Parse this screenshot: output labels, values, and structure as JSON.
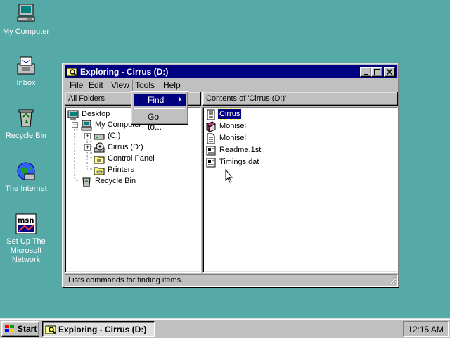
{
  "desktop": {
    "icons": [
      {
        "label": "My Computer",
        "icon": "computer-icon"
      },
      {
        "label": "Inbox",
        "icon": "inbox-icon"
      },
      {
        "label": "Recycle Bin",
        "icon": "recycle-bin-icon"
      },
      {
        "label": "The Internet",
        "icon": "internet-icon"
      },
      {
        "label": "Set Up The Microsoft Network",
        "icon": "msn-icon"
      }
    ],
    "background_color": "#55aaa8"
  },
  "window": {
    "title": "Exploring - Cirrus (D:)",
    "title_bar_color": "#000080",
    "menu": [
      {
        "label": "File",
        "hotkey_index": 0
      },
      {
        "label": "Edit",
        "hotkey_index": 0
      },
      {
        "label": "View",
        "hotkey_index": 0
      },
      {
        "label": "Tools",
        "hotkey_index": 0
      },
      {
        "label": "Help",
        "hotkey_index": 0
      }
    ],
    "left_header": "All Folders",
    "right_header": "Contents of 'Cirrus (D:)'",
    "tree": [
      {
        "label": "Desktop",
        "icon": "desktop-icon"
      },
      {
        "label": "My Computer",
        "icon": "computer-icon"
      },
      {
        "label": "(C:)",
        "icon": "drive-icon"
      },
      {
        "label": "Cirrus (D:)",
        "icon": "cd-drive-icon"
      },
      {
        "label": "Control Panel",
        "icon": "folder-icon"
      },
      {
        "label": "Printers",
        "icon": "folder-icon"
      },
      {
        "label": "Recycle Bin",
        "icon": "recycle-bin-icon"
      }
    ],
    "files": [
      {
        "label": "Cirrus",
        "icon": "app-icon",
        "selected": true
      },
      {
        "label": "Monisel",
        "icon": "book-icon",
        "selected": false
      },
      {
        "label": "Monisel",
        "icon": "document-icon",
        "selected": false
      },
      {
        "label": "Readme.1st",
        "icon": "text-file-icon",
        "selected": false
      },
      {
        "label": "Timings.dat",
        "icon": "data-file-icon",
        "selected": false
      }
    ],
    "status": "Lists commands for finding items."
  },
  "tools_menu": {
    "items": [
      {
        "label": "Find",
        "has_submenu": true,
        "highlighted": true
      },
      {
        "label": "Go to...",
        "has_submenu": false,
        "highlighted": false
      }
    ]
  },
  "taskbar": {
    "start_label": "Start",
    "task_label": "Exploring - Cirrus (D:)",
    "clock": "12:15 AM"
  }
}
